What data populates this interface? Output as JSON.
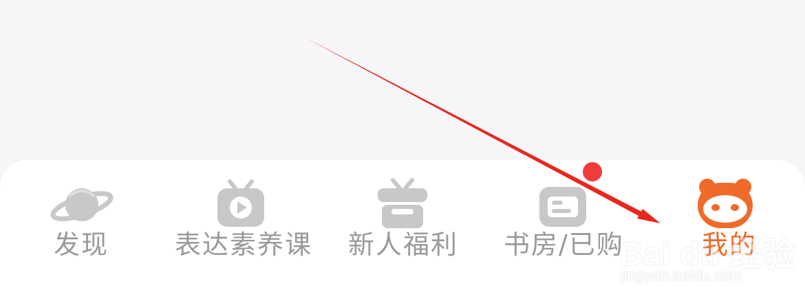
{
  "tabs": [
    {
      "label": "发现",
      "icon": "planet-icon",
      "active": false
    },
    {
      "label": "表达素养课",
      "icon": "tv-play-icon",
      "active": false
    },
    {
      "label": "新人福利",
      "icon": "gift-box-icon",
      "active": false
    },
    {
      "label": "书房/已购",
      "icon": "bookshelf-icon",
      "active": false,
      "badge": true
    },
    {
      "label": "我的",
      "icon": "panda-icon",
      "active": true
    }
  ],
  "watermark": {
    "logo": "Bai du 经验",
    "url": "jingyan.baidu.com"
  },
  "colors": {
    "inactive": "#9a9a9a",
    "active": "#f06a2a",
    "badge": "#ef3c3c",
    "arrow": "#e8281e"
  }
}
